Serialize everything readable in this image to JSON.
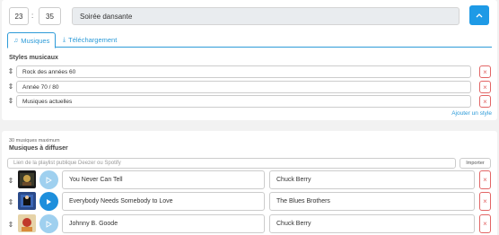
{
  "event": {
    "hour": "23",
    "minute": "35",
    "separator": ":",
    "name": "Soirée dansante"
  },
  "tabs": [
    {
      "label": "Musiques",
      "icon": "music-note-icon",
      "active": true
    },
    {
      "label": "Téléchargement",
      "icon": "download-icon",
      "active": false
    }
  ],
  "styles": {
    "heading": "Styles musicaux",
    "items": [
      "Rock des années 60",
      "Année 70 / 80",
      "Musiques actuelles"
    ],
    "add_label": "Ajouter un style",
    "delete_glyph": "×"
  },
  "music": {
    "max_note": "30 musiques maximum",
    "heading": "Musiques à diffuser",
    "playlist_placeholder": "Lien de la playlist publique Deezer ou Spotify",
    "import_label": "Importer",
    "songs": [
      {
        "title": "You Never Can Tell",
        "artist": "Chuck Berry"
      },
      {
        "title": "Everybody Needs Somebody to Love",
        "artist": "The Blues Brothers"
      },
      {
        "title": "Johnny B. Goode",
        "artist": "Chuck Berry"
      }
    ]
  },
  "colors": {
    "accent": "#1e9ae6",
    "danger": "#e26565",
    "background": "#f2f2f2"
  }
}
